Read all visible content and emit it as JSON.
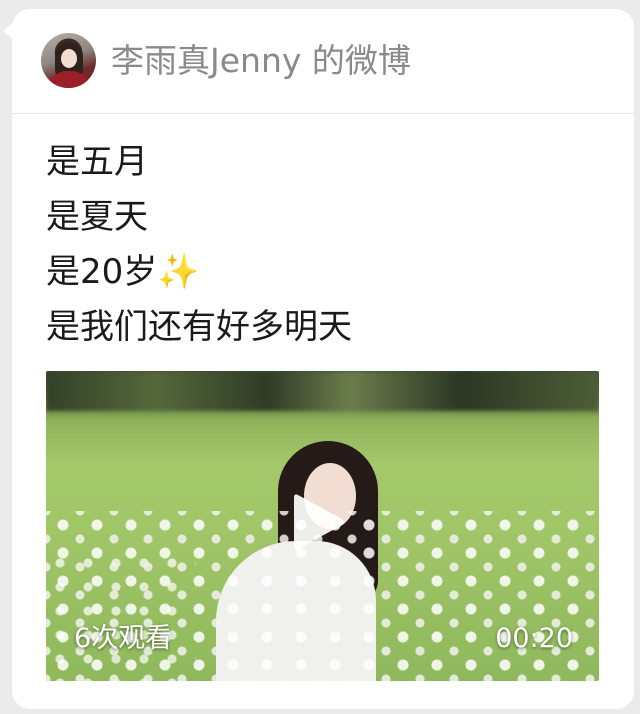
{
  "post": {
    "account_name": "李雨真Jenny 的微博",
    "text_lines": [
      "是五月",
      "是夏天",
      "是20岁✨",
      "是我们还有好多明天"
    ]
  },
  "video": {
    "view_count": "6次观看",
    "duration": "00:20",
    "play_icon": "play-icon"
  },
  "colors": {
    "background": "#ebebeb",
    "card": "#ffffff",
    "name_text": "#8a8a8a",
    "body_text": "#1a1a1a"
  }
}
